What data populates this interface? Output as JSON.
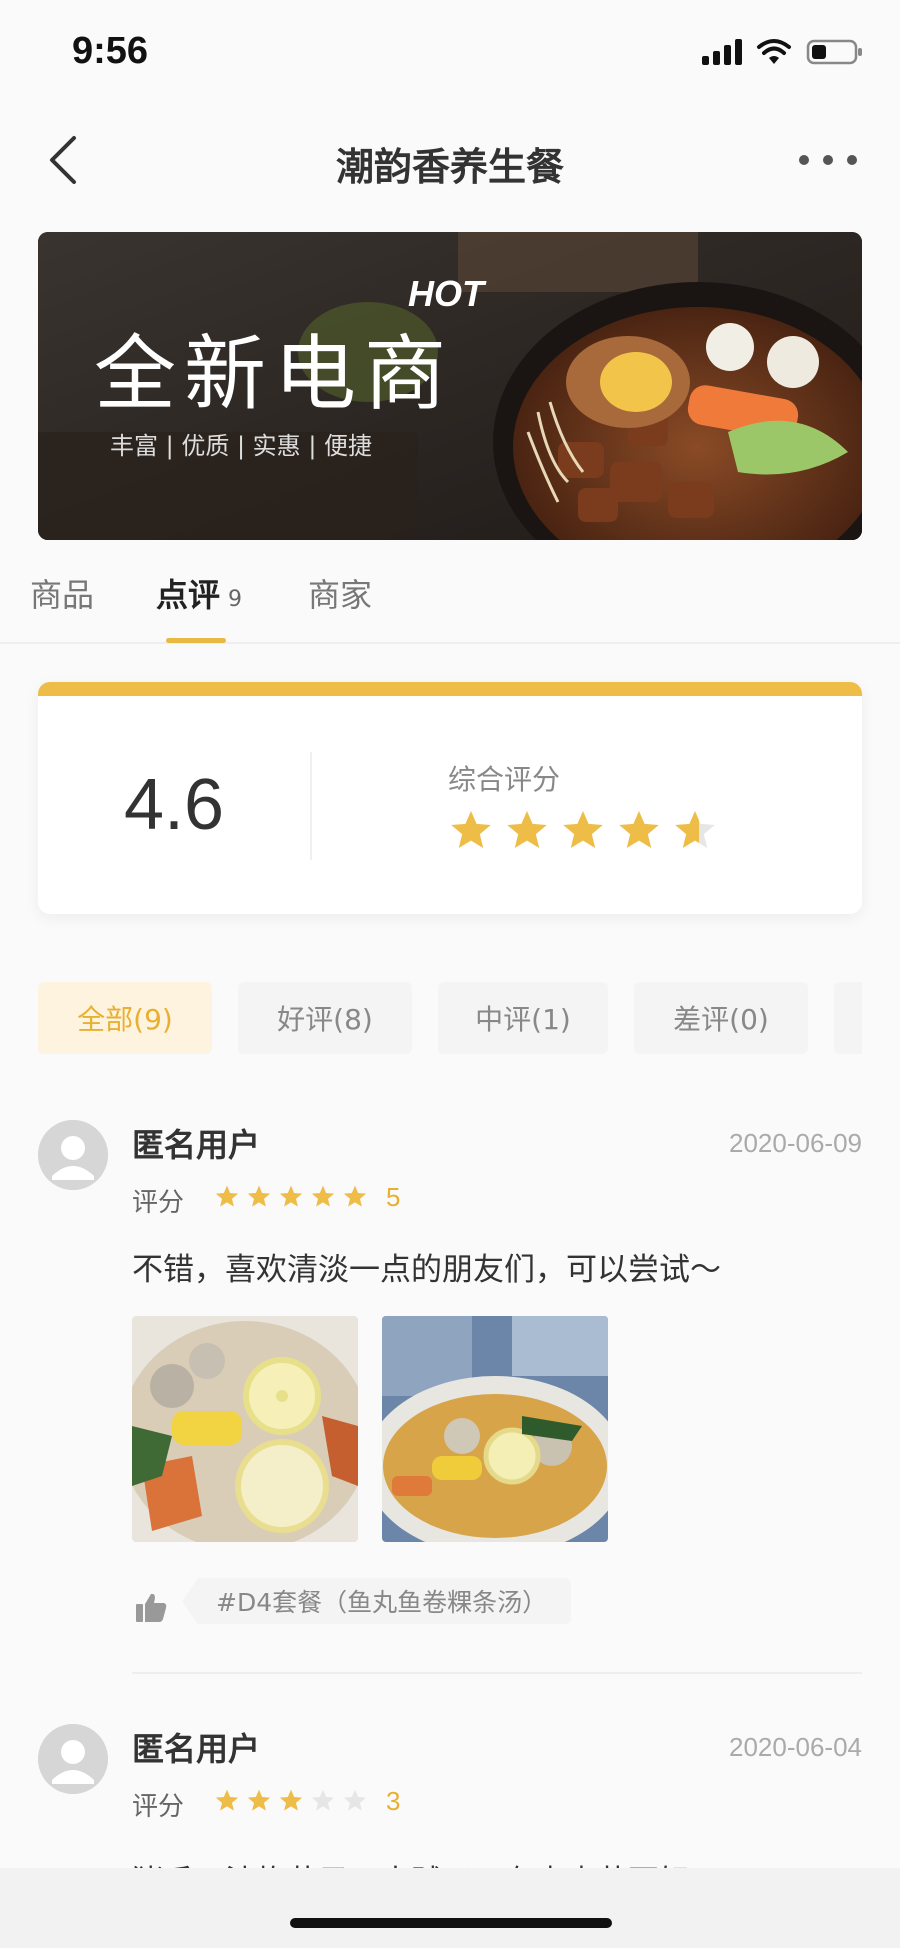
{
  "status": {
    "time": "9:56"
  },
  "nav": {
    "title": "潮韵香养生餐",
    "back_icon": "chevron-left-icon",
    "more_icon": "more-dots-icon"
  },
  "banner": {
    "hot": "HOT",
    "headline": "全新电商",
    "tagline": "丰富 | 优质 | 实惠 | 便捷"
  },
  "tabs": [
    {
      "label": "商品"
    },
    {
      "label": "点评",
      "count": "9"
    },
    {
      "label": "商家"
    }
  ],
  "rating": {
    "score": "4.6",
    "label": "综合评分",
    "stars": 4.6
  },
  "filters": [
    {
      "label": "全部(9)"
    },
    {
      "label": "好评(8)"
    },
    {
      "label": "中评(1)"
    },
    {
      "label": "差评(0)"
    }
  ],
  "reviews": [
    {
      "name": "匿名用户",
      "date": "2020-06-09",
      "score_label": "评分",
      "score": "5",
      "text": "不错，喜欢清淡一点的朋友们，可以尝试～",
      "tag": "#D4套餐（鱼丸鱼卷粿条汤）"
    },
    {
      "name": "匿名用户",
      "date": "2020-06-04",
      "score_label": "评分",
      "score": "3",
      "text": "猪手、油炸芋子，太贼了，有点麦芽不好"
    }
  ],
  "colors": {
    "accent": "#edbd47",
    "accent_text": "#e8b030",
    "star_empty": "#e6e6e6"
  }
}
